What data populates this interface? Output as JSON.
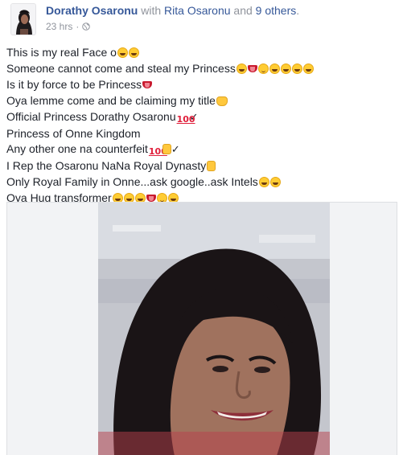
{
  "post": {
    "author": "Dorathy Osaronu",
    "with_prefix": "with",
    "with_tagged": "Rita Osaronu",
    "and_text": "and",
    "others": "9 others",
    "suffix": ".",
    "timestamp": "23 hrs",
    "separator": "·",
    "privacy_icon": "globe-icon"
  },
  "lines": [
    "This is my real Face o",
    "Someone cannot come and steal my Princess",
    "Is it by force to be Princess",
    "Oya lemme come and be claiming my title",
    "Official Princess Dorathy Osaronu",
    "Princess of Onne Kingdom",
    "Any other one na counterfeit",
    "I Rep the Osaronu NaNa Royal Dynasty",
    "Only Royal Family in Onne...ask google..ask Intels",
    "Oya Hug transformer"
  ],
  "glyphs": {
    "hundred": "100",
    "check": "✓"
  },
  "colors": {
    "link": "#365899",
    "meta": "#90949c",
    "text": "#1d2129",
    "photo_bg": "#f2f3f5",
    "border": "#dddfe2"
  }
}
